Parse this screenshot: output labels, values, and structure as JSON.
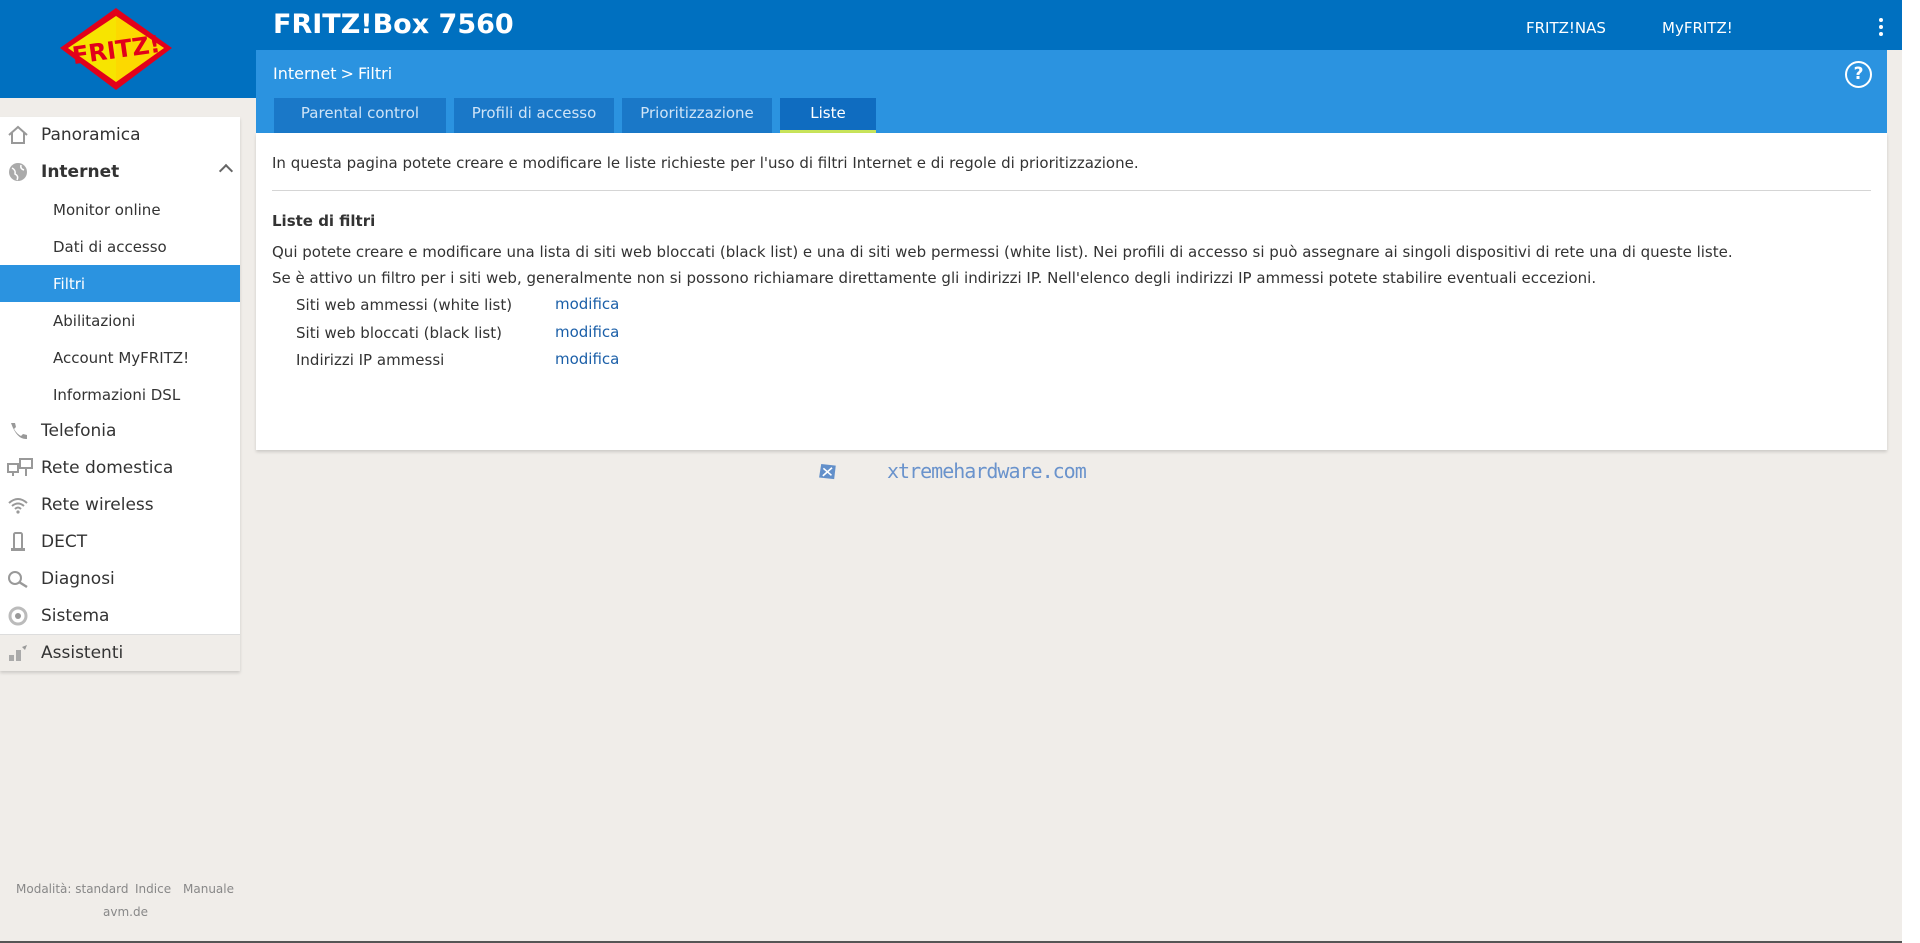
{
  "header": {
    "title": "FRITZ!Box 7560",
    "links": [
      "FRITZ!NAS",
      "MyFRITZ!"
    ],
    "logo_text": "FRITZ!"
  },
  "breadcrumb": {
    "parent": "Internet",
    "separator": ">",
    "current": "Filtri"
  },
  "tabs": [
    {
      "label": "Parental control"
    },
    {
      "label": "Profili di accesso"
    },
    {
      "label": "Prioritizzazione"
    },
    {
      "label": "Liste"
    }
  ],
  "active_tab": "Liste",
  "content": {
    "intro": "In questa pagina potete creare e modificare le liste richieste per l'uso di filtri Internet e di regole di prioritizzazione.",
    "section_title": "Liste di filtri",
    "para1": "Qui potete creare e modificare una lista di siti web bloccati (black list) e una di siti web permessi (white list). Nei profili di accesso si può assegnare ai singoli dispositivi di rete una di queste liste.",
    "para2": "Se è attivo un filtro per i siti web, generalmente non si possono richiamare direttamente gli indirizzi IP. Nell'elenco degli indirizzi IP ammessi potete stabilire eventuali eccezioni.",
    "rows": [
      {
        "label": "Siti web ammessi (white list)",
        "action": "modifica"
      },
      {
        "label": "Siti web bloccati (black list)",
        "action": "modifica"
      },
      {
        "label": "Indirizzi IP ammessi",
        "action": "modifica"
      }
    ]
  },
  "sidebar": {
    "items": [
      {
        "label": "Panoramica",
        "icon": "home-icon"
      },
      {
        "label": "Internet",
        "icon": "globe-icon"
      },
      {
        "label": "Telefonia",
        "icon": "phone-icon"
      },
      {
        "label": "Rete domestica",
        "icon": "network-icon"
      },
      {
        "label": "Rete wireless",
        "icon": "wifi-icon"
      },
      {
        "label": "DECT",
        "icon": "dect-icon"
      },
      {
        "label": "Diagnosi",
        "icon": "diagnosis-icon"
      },
      {
        "label": "Sistema",
        "icon": "system-icon"
      },
      {
        "label": "Assistenti",
        "icon": "wizard-icon"
      }
    ],
    "internet_sub": [
      {
        "label": "Monitor online"
      },
      {
        "label": "Dati di accesso"
      },
      {
        "label": "Filtri"
      },
      {
        "label": "Abilitazioni"
      },
      {
        "label": "Account MyFRITZ!"
      },
      {
        "label": "Informazioni DSL"
      }
    ],
    "active_sub": "Filtri"
  },
  "footer": {
    "mode": "Modalità: standard",
    "index": "Indice",
    "manual": "Manuale",
    "site": "avm.de"
  },
  "watermark": {
    "text": "xtremehardware.com"
  },
  "colors": {
    "header_blue": "#0070c0",
    "subheader_blue": "#2b93e0",
    "tab_active_underline": "#c8e45a",
    "link_blue": "#1b5fa8",
    "page_bg": "#f0ede9"
  }
}
